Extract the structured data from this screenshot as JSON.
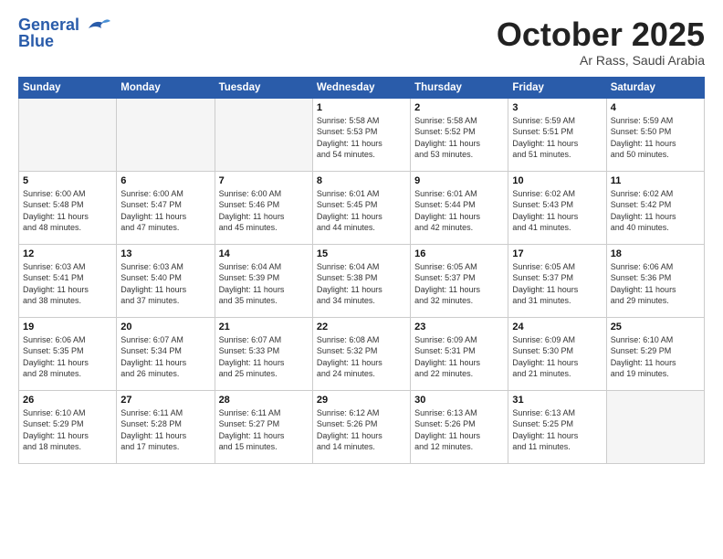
{
  "header": {
    "logo_general": "General",
    "logo_blue": "Blue",
    "month": "October 2025",
    "location": "Ar Rass, Saudi Arabia"
  },
  "weekdays": [
    "Sunday",
    "Monday",
    "Tuesday",
    "Wednesday",
    "Thursday",
    "Friday",
    "Saturday"
  ],
  "weeks": [
    [
      {
        "day": "",
        "info": ""
      },
      {
        "day": "",
        "info": ""
      },
      {
        "day": "",
        "info": ""
      },
      {
        "day": "1",
        "info": "Sunrise: 5:58 AM\nSunset: 5:53 PM\nDaylight: 11 hours\nand 54 minutes."
      },
      {
        "day": "2",
        "info": "Sunrise: 5:58 AM\nSunset: 5:52 PM\nDaylight: 11 hours\nand 53 minutes."
      },
      {
        "day": "3",
        "info": "Sunrise: 5:59 AM\nSunset: 5:51 PM\nDaylight: 11 hours\nand 51 minutes."
      },
      {
        "day": "4",
        "info": "Sunrise: 5:59 AM\nSunset: 5:50 PM\nDaylight: 11 hours\nand 50 minutes."
      }
    ],
    [
      {
        "day": "5",
        "info": "Sunrise: 6:00 AM\nSunset: 5:48 PM\nDaylight: 11 hours\nand 48 minutes."
      },
      {
        "day": "6",
        "info": "Sunrise: 6:00 AM\nSunset: 5:47 PM\nDaylight: 11 hours\nand 47 minutes."
      },
      {
        "day": "7",
        "info": "Sunrise: 6:00 AM\nSunset: 5:46 PM\nDaylight: 11 hours\nand 45 minutes."
      },
      {
        "day": "8",
        "info": "Sunrise: 6:01 AM\nSunset: 5:45 PM\nDaylight: 11 hours\nand 44 minutes."
      },
      {
        "day": "9",
        "info": "Sunrise: 6:01 AM\nSunset: 5:44 PM\nDaylight: 11 hours\nand 42 minutes."
      },
      {
        "day": "10",
        "info": "Sunrise: 6:02 AM\nSunset: 5:43 PM\nDaylight: 11 hours\nand 41 minutes."
      },
      {
        "day": "11",
        "info": "Sunrise: 6:02 AM\nSunset: 5:42 PM\nDaylight: 11 hours\nand 40 minutes."
      }
    ],
    [
      {
        "day": "12",
        "info": "Sunrise: 6:03 AM\nSunset: 5:41 PM\nDaylight: 11 hours\nand 38 minutes."
      },
      {
        "day": "13",
        "info": "Sunrise: 6:03 AM\nSunset: 5:40 PM\nDaylight: 11 hours\nand 37 minutes."
      },
      {
        "day": "14",
        "info": "Sunrise: 6:04 AM\nSunset: 5:39 PM\nDaylight: 11 hours\nand 35 minutes."
      },
      {
        "day": "15",
        "info": "Sunrise: 6:04 AM\nSunset: 5:38 PM\nDaylight: 11 hours\nand 34 minutes."
      },
      {
        "day": "16",
        "info": "Sunrise: 6:05 AM\nSunset: 5:37 PM\nDaylight: 11 hours\nand 32 minutes."
      },
      {
        "day": "17",
        "info": "Sunrise: 6:05 AM\nSunset: 5:37 PM\nDaylight: 11 hours\nand 31 minutes."
      },
      {
        "day": "18",
        "info": "Sunrise: 6:06 AM\nSunset: 5:36 PM\nDaylight: 11 hours\nand 29 minutes."
      }
    ],
    [
      {
        "day": "19",
        "info": "Sunrise: 6:06 AM\nSunset: 5:35 PM\nDaylight: 11 hours\nand 28 minutes."
      },
      {
        "day": "20",
        "info": "Sunrise: 6:07 AM\nSunset: 5:34 PM\nDaylight: 11 hours\nand 26 minutes."
      },
      {
        "day": "21",
        "info": "Sunrise: 6:07 AM\nSunset: 5:33 PM\nDaylight: 11 hours\nand 25 minutes."
      },
      {
        "day": "22",
        "info": "Sunrise: 6:08 AM\nSunset: 5:32 PM\nDaylight: 11 hours\nand 24 minutes."
      },
      {
        "day": "23",
        "info": "Sunrise: 6:09 AM\nSunset: 5:31 PM\nDaylight: 11 hours\nand 22 minutes."
      },
      {
        "day": "24",
        "info": "Sunrise: 6:09 AM\nSunset: 5:30 PM\nDaylight: 11 hours\nand 21 minutes."
      },
      {
        "day": "25",
        "info": "Sunrise: 6:10 AM\nSunset: 5:29 PM\nDaylight: 11 hours\nand 19 minutes."
      }
    ],
    [
      {
        "day": "26",
        "info": "Sunrise: 6:10 AM\nSunset: 5:29 PM\nDaylight: 11 hours\nand 18 minutes."
      },
      {
        "day": "27",
        "info": "Sunrise: 6:11 AM\nSunset: 5:28 PM\nDaylight: 11 hours\nand 17 minutes."
      },
      {
        "day": "28",
        "info": "Sunrise: 6:11 AM\nSunset: 5:27 PM\nDaylight: 11 hours\nand 15 minutes."
      },
      {
        "day": "29",
        "info": "Sunrise: 6:12 AM\nSunset: 5:26 PM\nDaylight: 11 hours\nand 14 minutes."
      },
      {
        "day": "30",
        "info": "Sunrise: 6:13 AM\nSunset: 5:26 PM\nDaylight: 11 hours\nand 12 minutes."
      },
      {
        "day": "31",
        "info": "Sunrise: 6:13 AM\nSunset: 5:25 PM\nDaylight: 11 hours\nand 11 minutes."
      },
      {
        "day": "",
        "info": ""
      }
    ]
  ]
}
